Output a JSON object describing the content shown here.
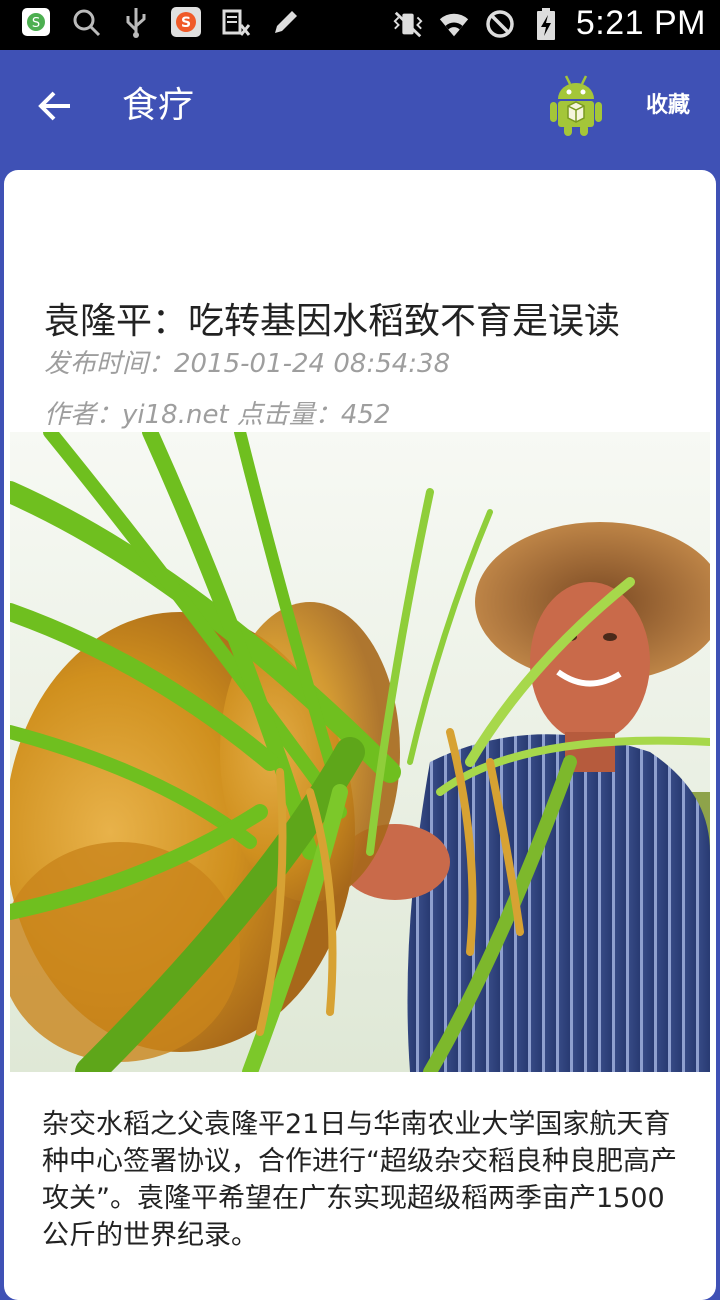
{
  "status_bar": {
    "time": "5:21 PM",
    "icons": [
      "sogou-search-icon",
      "search-icon",
      "usb-icon",
      "sogou-input-icon",
      "reader-icon",
      "pencil-icon",
      "vibrate-icon",
      "wifi-icon",
      "do-not-disturb-icon",
      "battery-charging-icon"
    ]
  },
  "appbar": {
    "title": "食疗",
    "favorite_label": "收藏",
    "icons": [
      "back-arrow-icon",
      "android-icon"
    ]
  },
  "article": {
    "headline": "袁隆平：吃转基因水稻致不育是误读",
    "publish_time": "发布时间：2015-01-24 08:54:38",
    "author_line": "作者：yi18.net 点击量：452",
    "body": "杂交水稻之父袁隆平21日与华南农业大学国家航天育种中心签署协议，合作进行“超级杂交稻良种良肥高产攻关”。袁隆平希望在广东实现超级稻两季亩产1500公斤的世界纪录。"
  },
  "colors": {
    "appbar": "#3f51b5",
    "status_bar": "#000000",
    "meta_text": "#9e9e9e",
    "android_green": "#a4c639"
  }
}
